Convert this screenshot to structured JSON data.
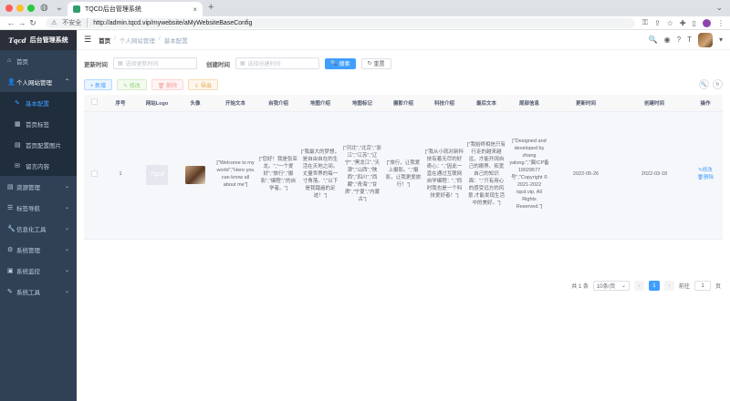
{
  "browser": {
    "tab_title": "TQCD后台管理系统",
    "tab_close": "×",
    "new_tab": "+",
    "security_label": "不安全",
    "url": "http://admin.tqcd.vip/mywebsite/aMyWebsiteBaseConfig",
    "strip_right": "⌄"
  },
  "sidebar": {
    "logo_mark": "Tqcd",
    "logo_text": "后台管理系统",
    "items": [
      {
        "label": "首页",
        "icon": "⌂"
      },
      {
        "label": "个人网站管理",
        "icon": "👤",
        "arrow": "⌃"
      },
      {
        "label": "资源管理",
        "icon": "▤",
        "arrow": "⌄"
      },
      {
        "label": "标签导航",
        "icon": "☰",
        "arrow": "⌄"
      },
      {
        "label": "信息化工具",
        "icon": "🔧",
        "arrow": "⌄"
      },
      {
        "label": "系统管理",
        "icon": "⚙",
        "arrow": "⌄"
      },
      {
        "label": "系统监控",
        "icon": "▣",
        "arrow": "⌄"
      },
      {
        "label": "系统工具",
        "icon": "✎",
        "arrow": "⌄"
      }
    ],
    "subitems": [
      {
        "label": "基本配置",
        "icon": "✎"
      },
      {
        "label": "首页标签",
        "icon": "▦"
      },
      {
        "label": "首页配置图片",
        "icon": "▤"
      },
      {
        "label": "留言内容",
        "icon": "✉"
      }
    ]
  },
  "navbar": {
    "hamburger": "☰",
    "crumbs": [
      "首页",
      "个人网站管理",
      "基本配置"
    ],
    "sep": "/",
    "icons": [
      "🔍",
      "◉",
      "?",
      "T"
    ]
  },
  "search": {
    "update_label": "更新时间",
    "update_placeholder": "选择更新时间",
    "create_label": "创建时间",
    "create_placeholder": "选择创建时间",
    "search_btn": "搜索",
    "reset_btn": "重置",
    "calendar_icon": "▦",
    "search_icon": "🔍",
    "reset_icon": "↻"
  },
  "actions": {
    "add": "+ 新增",
    "edit": "✎ 修改",
    "delete": "🗑 删除",
    "export": "⇩ 导出",
    "tool_search": "🔍",
    "tool_refresh": "↻"
  },
  "table": {
    "headers": [
      "",
      "序号",
      "网站Logo",
      "头像",
      "开始文本",
      "自我介绍",
      "地图介绍",
      "地图标记",
      "摄影介绍",
      "科技介绍",
      "最后文本",
      "尾部信息",
      "更新时间",
      "创建时间",
      "操作"
    ],
    "row": {
      "index": "1",
      "logo_text": "Tqcd",
      "start_text": "[\"Welcome to my world\",\"Here you can know all about me\"]",
      "self_intro": "[\"您好！我是张亚龙。\",\"一个爱好\",\"旅行\",\"摄影\",\"编程\",\"的自学者。\"]",
      "map_intro": "[\"我最大的梦想，是自由自在的生活在天地之间。丈量世界的每一寸角落。\",\"以下是我踏遍的足迹！\"]",
      "map_mark": "[\"河北\",\"北京\",\"浙江\",\"江苏\",\"辽宁\",\"黑龙江\",\"天津\",\"山西\",\"陕西\",\"四川\",\"西藏\",\"青海\",\"甘肃\",\"宁夏\",\"内蒙古\"]",
      "photo_intro": "[\"旅行，让我爱上摄影。\",\"摄影，让我更爱旅行！\"]",
      "tech_intro": "[\"我从小就对新科技有着无尽的好奇心：\",\"因此一直在通过互联网自学编程：\",\"同时我也是一个科技爱好者！\"]",
      "last_text": "[\"我始终相信只有行走的越来越远，才能开阔自己的眼界、拓宽自己的知识面：\",\"只有用心的感受远方的风景,才能发现生活中的美好。\"]",
      "footer_info": "[\"Designed and developed by zhang yalong.\",\"冀ICP备19029577号\",\"Copyright © 2021-2022 tqcd.vip. All Rights Reserved.\"]",
      "update_time": "2022-05-26",
      "create_time": "2022-03-18",
      "op_edit": "✎修改",
      "op_delete": "🗑删除"
    }
  },
  "pager": {
    "total": "共 1 条",
    "page_size": "10条/页",
    "prev": "‹",
    "page": "1",
    "next": "›",
    "goto": "前往",
    "goto_value": "1",
    "page_unit": "页",
    "dropdown_arrow": "⌄"
  }
}
